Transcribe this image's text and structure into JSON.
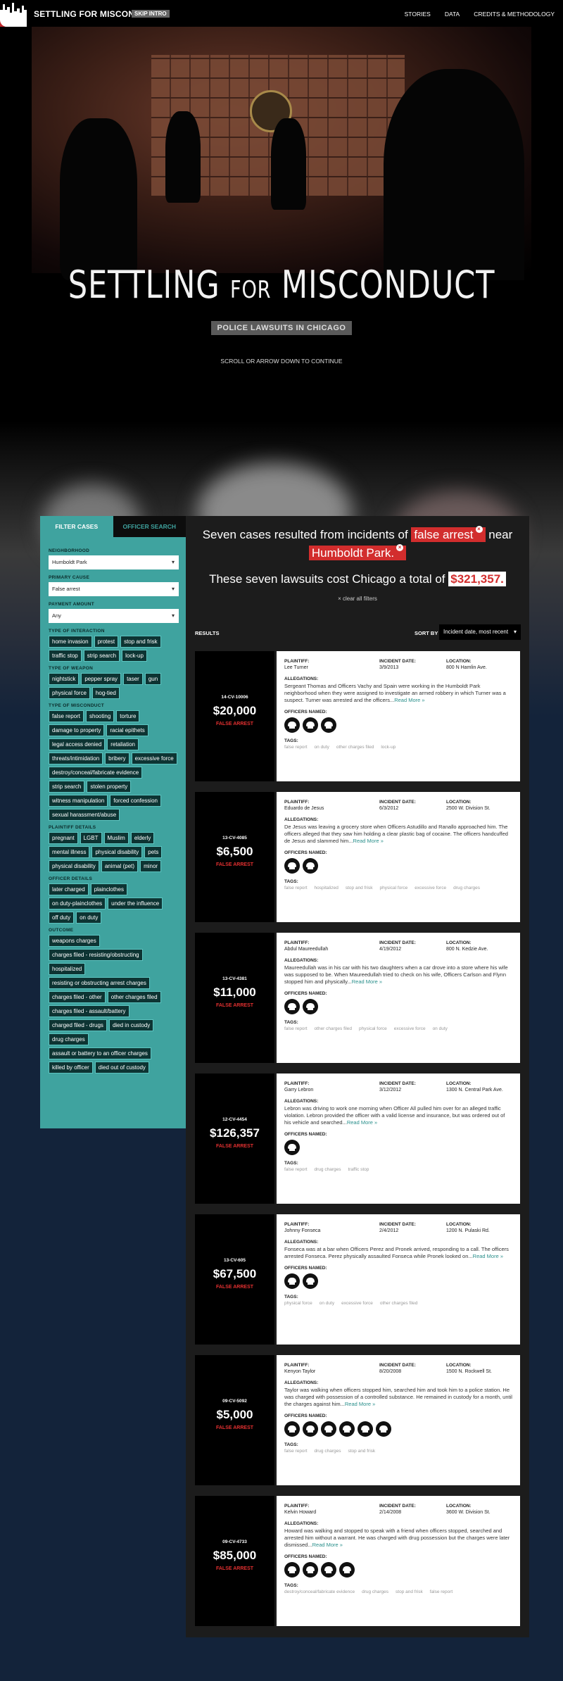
{
  "nav": {
    "title": "SETTLING FOR MISCONDUCT",
    "skip_intro": "SKIP INTRO",
    "links": [
      "STORIES",
      "DATA",
      "CREDITS & METHODOLOGY"
    ]
  },
  "hero": {
    "title_a": "SETTLING ",
    "title_b": "FOR",
    "title_c": " MISCONDUCT",
    "subtitle": "POLICE LAWSUITS IN CHICAGO",
    "scroll_hint": "SCROLL OR ARROW DOWN TO CONTINUE"
  },
  "sidebar": {
    "tabs": [
      "FILTER CASES",
      "OFFICER SEARCH"
    ],
    "neighborhood_label": "NEIGHBORHOOD",
    "neighborhood_value": "Humboldt Park",
    "primary_cause_label": "PRIMARY CAUSE",
    "primary_cause_value": "False arrest",
    "payment_label": "PAYMENT AMOUNT",
    "payment_value": "Any",
    "groups": [
      {
        "label": "TYPE OF INTERACTION",
        "tags": [
          "home invasion",
          "protest",
          "stop and frisk",
          "traffic stop",
          "strip search",
          "lock-up"
        ]
      },
      {
        "label": "TYPE OF WEAPON",
        "tags": [
          "nightstick",
          "pepper spray",
          "taser",
          "gun",
          "physical force",
          "hog-tied"
        ]
      },
      {
        "label": "TYPE OF MISCONDUCT",
        "tags": [
          "false report",
          "shooting",
          "torture",
          "damage to property",
          "racial epithets",
          "legal access denied",
          "retaliation",
          "threats/intimidation",
          "bribery",
          "excessive force",
          "destroy/conceal/fabricate evidence",
          "strip search",
          "stolen property",
          "witness manipulation",
          "forced confession",
          "sexual harassment/abuse"
        ]
      },
      {
        "label": "PLAINTIFF DETAILS",
        "tags": [
          "pregnant",
          "LGBT",
          "Muslim",
          "elderly",
          "mental illness",
          "physical disability",
          "pets",
          "physical disability",
          "animal (pet)",
          "minor"
        ]
      },
      {
        "label": "OFFICER DETAILS",
        "tags": [
          "later charged",
          "plainclothes",
          "on duty-plainclothes",
          "under the influence",
          "off duty",
          "on duty"
        ]
      },
      {
        "label": "OUTCOME",
        "tags": [
          "weapons charges",
          "charges filed - resisting/obstructing",
          "hospitalized",
          "resisting or obstructing arrest charges",
          "charges filed - other",
          "other charges filed",
          "charges filed - assault/battery",
          "charged filed - drugs",
          "died in custody",
          "drug charges",
          "assault or battery to an officer charges",
          "killed by officer",
          "died out of custody"
        ]
      }
    ]
  },
  "summary": {
    "line1_a": "Seven cases resulted from incidents of ",
    "line1_hl1": "false arrest",
    "line1_b": " near ",
    "line1_hl2": "Humboldt Park.",
    "line2_a": "These seven lawsuits cost Chicago a total of ",
    "line2_amt": "$321,357.",
    "clear": "×  clear all filters"
  },
  "results": {
    "label": "RESULTS",
    "sort_label": "SORT BY",
    "sort_value": "Incident date, most recent",
    "labels": {
      "plaintiff": "PLAINTIFF:",
      "date": "INCIDENT DATE:",
      "location": "LOCATION:",
      "allegations": "ALLEGATIONS:",
      "officers": "OFFICERS NAMED:",
      "tags": "TAGS:",
      "more": "Read More »"
    },
    "cases": [
      {
        "num": "14-CV-10006",
        "amount": "$20,000",
        "cause": "FALSE ARREST",
        "plaintiff": "Lee Turner",
        "date": "3/9/2013",
        "location": "800 N Hamlin Ave.",
        "allegations": "Sergeant Thomas and Officers Vachy and Spain were working in the Humboldt Park neighborhood when they were assigned to investigate an armed robbery in which Turner was a suspect. Turner was arrested and the officers...",
        "officers": 3,
        "tags": [
          "false report",
          "on duty",
          "other charges filed",
          "lock-up"
        ]
      },
      {
        "num": "13-CV-4085",
        "amount": "$6,500",
        "cause": "FALSE ARREST",
        "plaintiff": "Eduardo de Jesus",
        "date": "6/3/2012",
        "location": "2500 W. Division St.",
        "allegations": "De Jesus was leaving a grocery store when Officers Astudillo and Ranallo approached him. The officers alleged that they saw him holding a clear plastic bag of cocaine. The officers handcuffed de Jesus and slammed him...",
        "officers": 2,
        "tags": [
          "false report",
          "hospitalized",
          "stop and frisk",
          "physical force",
          "excessive force",
          "drug charges"
        ]
      },
      {
        "num": "13-CV-4381",
        "amount": "$11,000",
        "cause": "FALSE ARREST",
        "plaintiff": "Abdul Maureedullah",
        "date": "4/19/2012",
        "location": "800 N. Kedzie Ave.",
        "allegations": "Maureedullah was in his car with his two daughters when a car drove into a store where his wife was supposed to be. When Maureedullah tried to check on his wife, Officers Carlson and Flynn stopped him and physically...",
        "officers": 2,
        "tags": [
          "false report",
          "other charges filed",
          "physical force",
          "excessive force",
          "on duty"
        ]
      },
      {
        "num": "12-CV-4454",
        "amount": "$126,357",
        "cause": "FALSE ARREST",
        "plaintiff": "Garry Lebron",
        "date": "3/12/2012",
        "location": "1300 N. Central Park Ave.",
        "allegations": "Lebron was driving to work one morning when Officer All pulled him over for an alleged traffic violation. Lebron provided the officer with a valid license and insurance, but was ordered out of his vehicle and searched...",
        "officers": 1,
        "tags": [
          "false report",
          "drug charges",
          "traffic stop"
        ]
      },
      {
        "num": "13-CV-605",
        "amount": "$67,500",
        "cause": "FALSE ARREST",
        "plaintiff": "Johnny Fonseca",
        "date": "2/4/2012",
        "location": "1200 N. Pulaski Rd.",
        "allegations": "Fonseca was at a bar when Officers Perez and Pronek arrived, responding to a call. The officers arrested Fonseca. Perez physically assaulted Fonseca while Pronek looked on...",
        "officers": 2,
        "tags": [
          "physical force",
          "on duty",
          "excessive force",
          "other charges filed"
        ]
      },
      {
        "num": "09-CV-5092",
        "amount": "$5,000",
        "cause": "FALSE ARREST",
        "plaintiff": "Kenyon Taylor",
        "date": "8/20/2008",
        "location": "1500 N. Rockwell St.",
        "allegations": "Taylor was walking when officers stopped him, searched him and took him to a police station. He was charged with possession of a controlled substance. He remained in custody for a month, until the charges against him...",
        "officers": 6,
        "tags": [
          "false report",
          "drug charges",
          "stop and frisk"
        ]
      },
      {
        "num": "09-CV-4733",
        "amount": "$85,000",
        "cause": "FALSE ARREST",
        "plaintiff": "Kelvin Howard",
        "date": "2/14/2008",
        "location": "3600 W. Division St.",
        "allegations": "Howard was walking and stopped to speak with a friend when officers stopped, searched and arrested him without a warrant. He was charged with drug possession but the charges were later dismissed...",
        "officers": 4,
        "tags": [
          "destroy/conceal/fabricate evidence",
          "drug charges",
          "stop and frisk",
          "false report"
        ]
      }
    ]
  }
}
